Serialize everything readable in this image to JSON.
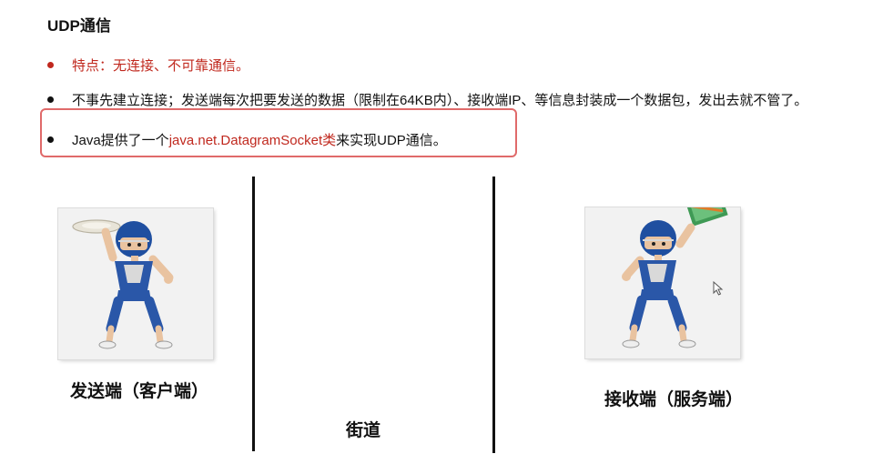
{
  "slide": {
    "title": "UDP通信",
    "bullets": [
      {
        "text": "特点：无连接、不可靠通信。"
      },
      {
        "text": "不事先建立连接；发送端每次把要发送的数据（限制在64KB内）、接收端IP、等信息封装成一个数据包，发出去就不管了。"
      },
      {
        "prefix": "Java提供了一个",
        "highlight": "java.net.DatagramSocket类",
        "suffix": "来实现UDP通信。"
      }
    ],
    "colors": {
      "accent": "#c0281e",
      "callout_border": "#e06a6a",
      "text": "#111111"
    }
  },
  "diagram": {
    "sender_label": "发送端（客户端）",
    "street_label": "街道",
    "receiver_label": "接收端（服务端）",
    "sender_icon": "player-holding-plate-icon",
    "receiver_icon": "player-with-package-icon"
  }
}
